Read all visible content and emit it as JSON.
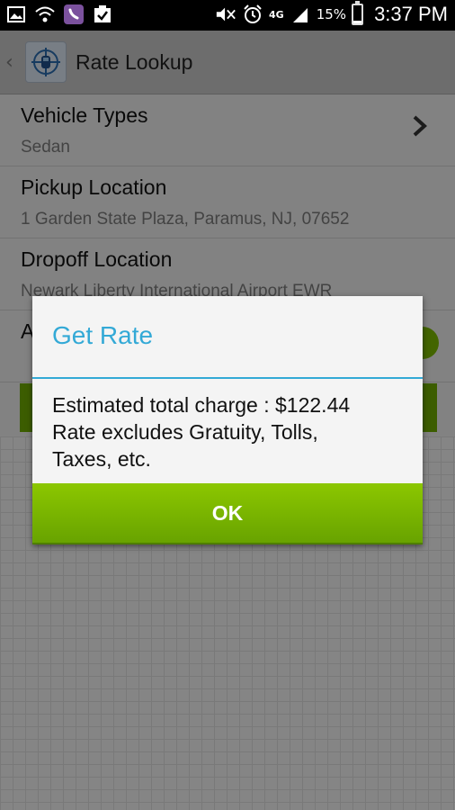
{
  "status_bar": {
    "battery_percent": "15%",
    "battery_level": 0.15,
    "network": "4G",
    "time": "3:37 PM",
    "left_icons": [
      "gallery-icon",
      "wifi-icon",
      "viber-icon",
      "checklist-icon"
    ],
    "right_icons": [
      "mute-icon",
      "alarm-icon",
      "lte-icon",
      "signal-icon",
      "battery-icon"
    ]
  },
  "action_bar": {
    "title": "Rate Lookup",
    "icon": "app-logo-icon"
  },
  "form": {
    "rows": [
      {
        "label": "Vehicle Types",
        "value": "Sedan"
      },
      {
        "label": "Pickup Location",
        "value": "1 Garden State Plaza, Paramus, NJ, 07652"
      },
      {
        "label": "Dropoff Location",
        "value": "Newark Liberty International Airport EWR"
      },
      {
        "label": "A",
        "value": ""
      }
    ]
  },
  "dialog": {
    "title": "Get Rate",
    "message": "Estimated total charge : $122.44\nRate excludes Gratuity, Tolls,\nTaxes, etc.",
    "ok_label": "OK"
  },
  "colors": {
    "accent_blue": "#33a9d6",
    "button_green": "#7ab800",
    "overlay": "rgba(0,0,0,0.45)"
  }
}
